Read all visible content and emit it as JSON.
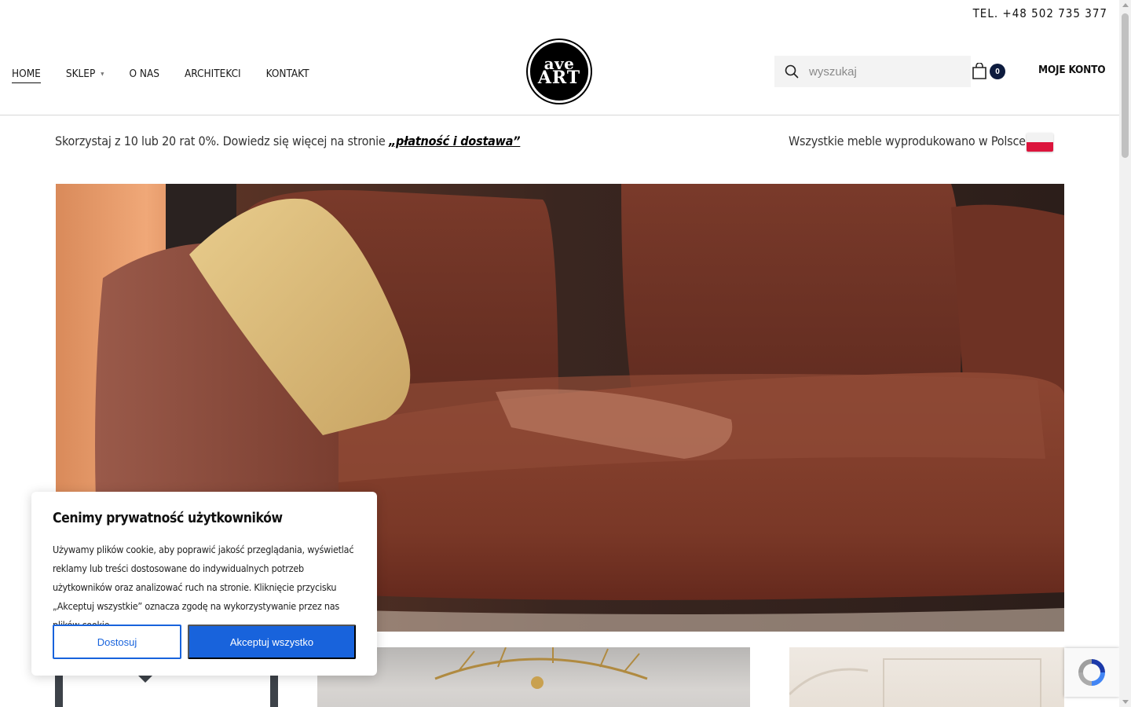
{
  "header": {
    "phone": "TEL. +48 502 735 377",
    "nav": [
      {
        "label": "HOME"
      },
      {
        "label": "SKLEP"
      },
      {
        "label": "O NAS"
      },
      {
        "label": "ARCHITEKCI"
      },
      {
        "label": "KONTAKT"
      }
    ],
    "logo": {
      "line1": "ave",
      "line2": "ART"
    },
    "search": {
      "placeholder": "wyszukaj",
      "icon": "search-icon"
    },
    "cart": {
      "count": "0",
      "icon": "shopping-bag-icon"
    },
    "account_label": "MOJE KONTO"
  },
  "promo": {
    "left_text": "Skorzystaj z 10 lub 20 rat 0%. Dowiedz się więcej na stronie ",
    "left_link": "„płatność i dostawa”",
    "right_text": "Wszystkie meble wyprodukowano w Polsce!",
    "flag_icon": "poland-flag-icon"
  },
  "cookie": {
    "title": "Cenimy prywatność użytkowników",
    "body": "Używamy plików cookie, aby poprawić jakość przeglądania, wyświetlać reklamy lub treści dostosowane do indywidualnych potrzeb użytkowników oraz analizować ruch na stronie. Kliknięcie przycisku „Akceptuj wszystkie” oznacza zgodę na wykorzystywanie przez nas plików cookie.",
    "customize_label": "Dostosuj",
    "accept_label": "Akceptuj wszystko"
  },
  "colors": {
    "accent": "#1863dc",
    "cart_badge": "#0d1b3e",
    "header_border": "#d6d6d6"
  }
}
